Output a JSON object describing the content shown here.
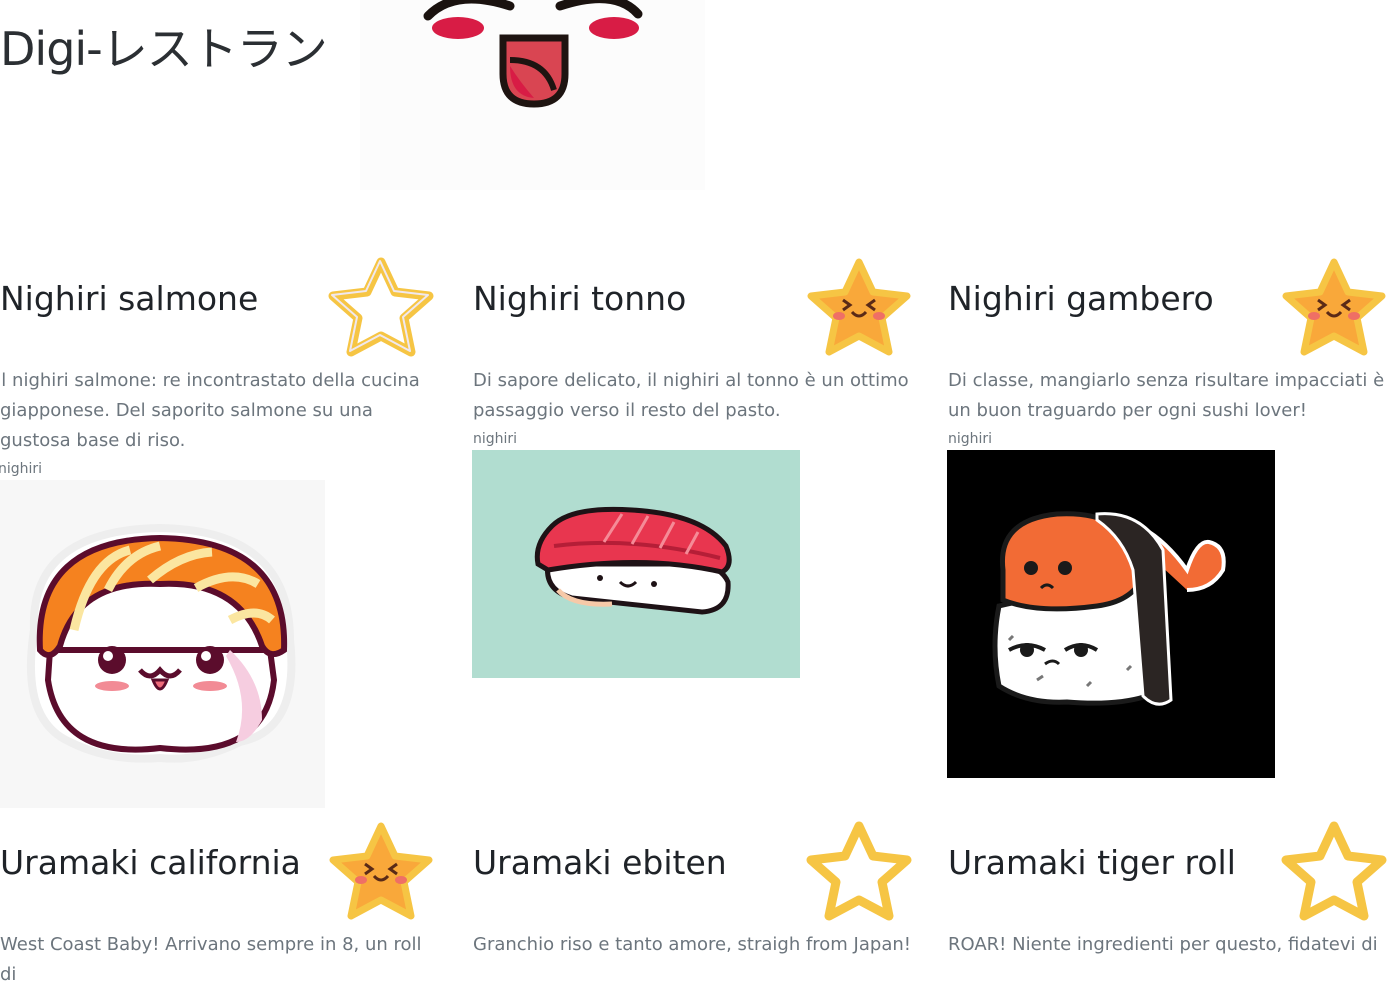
{
  "site": {
    "title": "Digi-レストラン"
  },
  "logo": {
    "icon": "smiling-face-logo"
  },
  "dishes": [
    {
      "name": "Nighiri salmone",
      "description": "Il nighiri salmone: re incontrastato della cucina giapponese. Del saporito salmone su una gustosa base di riso.",
      "category": "nighiri",
      "favorite": false,
      "image_icon": "salmon-nigiri-illustration"
    },
    {
      "name": "Nighiri tonno",
      "description": "Di sapore delicato, il nighiri al tonno è un ottimo passaggio verso il resto del pasto.",
      "category": "nighiri",
      "favorite": true,
      "image_icon": "tuna-nigiri-illustration"
    },
    {
      "name": "Nighiri gambero",
      "description": "Di classe, mangiarlo senza risultare impacciati è un buon traguardo per ogni sushi lover!",
      "category": "nighiri",
      "favorite": true,
      "image_icon": "shrimp-nigiri-illustration"
    },
    {
      "name": "Uramaki california",
      "description": "West Coast Baby! Arrivano sempre in 8, un roll di",
      "favorite": true
    },
    {
      "name": "Uramaki ebiten",
      "description": "Granchio riso e tanto amore, straigh from Japan!",
      "favorite": false
    },
    {
      "name": "Uramaki tiger roll",
      "description": "ROAR! Niente ingredienti per questo, fidatevi di",
      "favorite": false
    }
  ],
  "colors": {
    "star_fill": "#f9a83a",
    "star_outline": "#f6c544",
    "tuna_bg": "#b1ddd0",
    "shrimp_bg": "#000000",
    "salmon_bg": "#f7f7f7"
  }
}
